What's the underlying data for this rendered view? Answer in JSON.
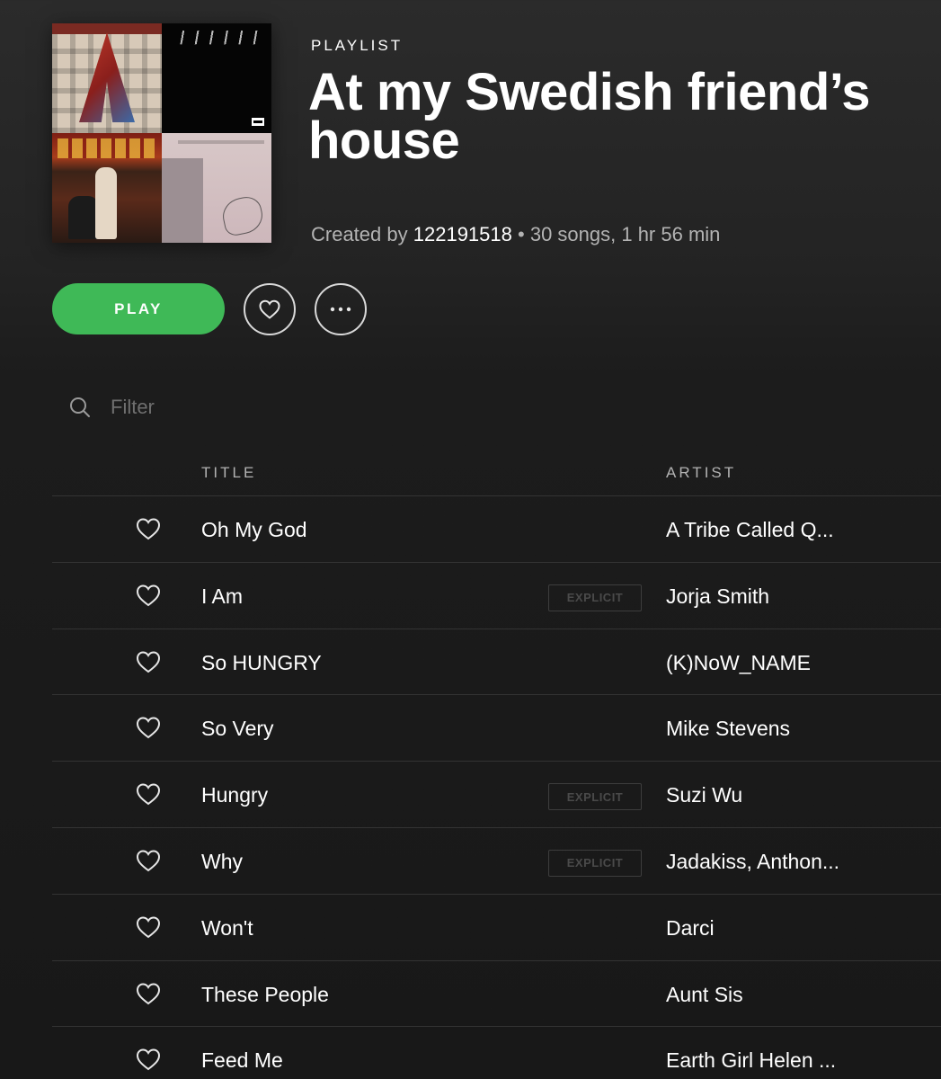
{
  "header": {
    "eyebrow": "PLAYLIST",
    "title": "At my Swedish friend’s house",
    "created_by_label": "Created by",
    "owner": "122191518",
    "separator": "•",
    "summary": "30 songs, 1 hr 56 min"
  },
  "actions": {
    "play_label": "PLAY",
    "heart_icon": "heart-outline-icon",
    "more_icon": "ellipsis-icon"
  },
  "filter": {
    "placeholder": "Filter",
    "value": ""
  },
  "table": {
    "columns": [
      "TITLE",
      "ARTIST"
    ],
    "rows": [
      {
        "title": "Oh My God",
        "artist": "A Tribe Called Q...",
        "explicit": ""
      },
      {
        "title": "I Am",
        "artist": "Jorja Smith",
        "explicit": "EXPLICIT"
      },
      {
        "title": "So HUNGRY",
        "artist": "(K)NoW_NAME",
        "explicit": ""
      },
      {
        "title": "So Very",
        "artist": "Mike Stevens",
        "explicit": ""
      },
      {
        "title": "Hungry",
        "artist": "Suzi Wu",
        "explicit": "EXPLICIT"
      },
      {
        "title": "Why",
        "artist": "Jadakiss, Anthon...",
        "explicit": "EXPLICIT"
      },
      {
        "title": "Won't",
        "artist": "Darci",
        "explicit": ""
      },
      {
        "title": "These People",
        "artist": "Aunt Sis",
        "explicit": ""
      },
      {
        "title": "Feed Me",
        "artist": "Earth Girl Helen ...",
        "explicit": ""
      }
    ]
  },
  "colors": {
    "accent": "#3fb957",
    "background": "#181818",
    "text_secondary": "#b3b3b3"
  }
}
